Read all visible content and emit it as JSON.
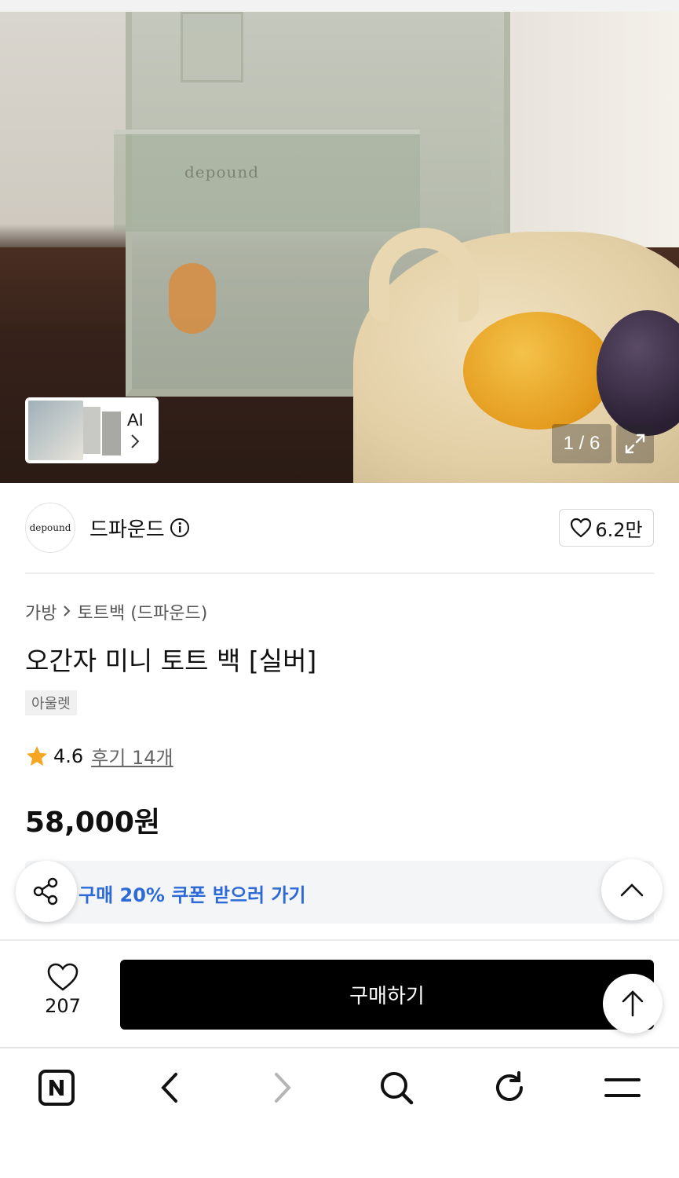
{
  "gallery": {
    "counter": "1 / 6",
    "ai_label": "AI",
    "bag_logo_text": "depound"
  },
  "brand": {
    "logo_text": "depound",
    "name": "드파운드",
    "likes": "6.2만"
  },
  "product": {
    "breadcrumb": [
      "가방",
      "토트백 (드파운드)"
    ],
    "title": "오간자 미니 토트 백 [실버]",
    "badge": "아울렛",
    "rating": "4.6",
    "reviews": "후기 14개",
    "price": "58,000원"
  },
  "coupon": {
    "text": "구매 20% 쿠폰 받으러 가기"
  },
  "purchase": {
    "wish_count": "207",
    "buy_label": "구매하기"
  },
  "nav": {
    "items": [
      "naver-home",
      "back",
      "forward",
      "search",
      "refresh",
      "menu"
    ]
  },
  "colors": {
    "coupon_text": "#2d6ad8",
    "star": "#f5a623",
    "buy_button": "#000000"
  }
}
